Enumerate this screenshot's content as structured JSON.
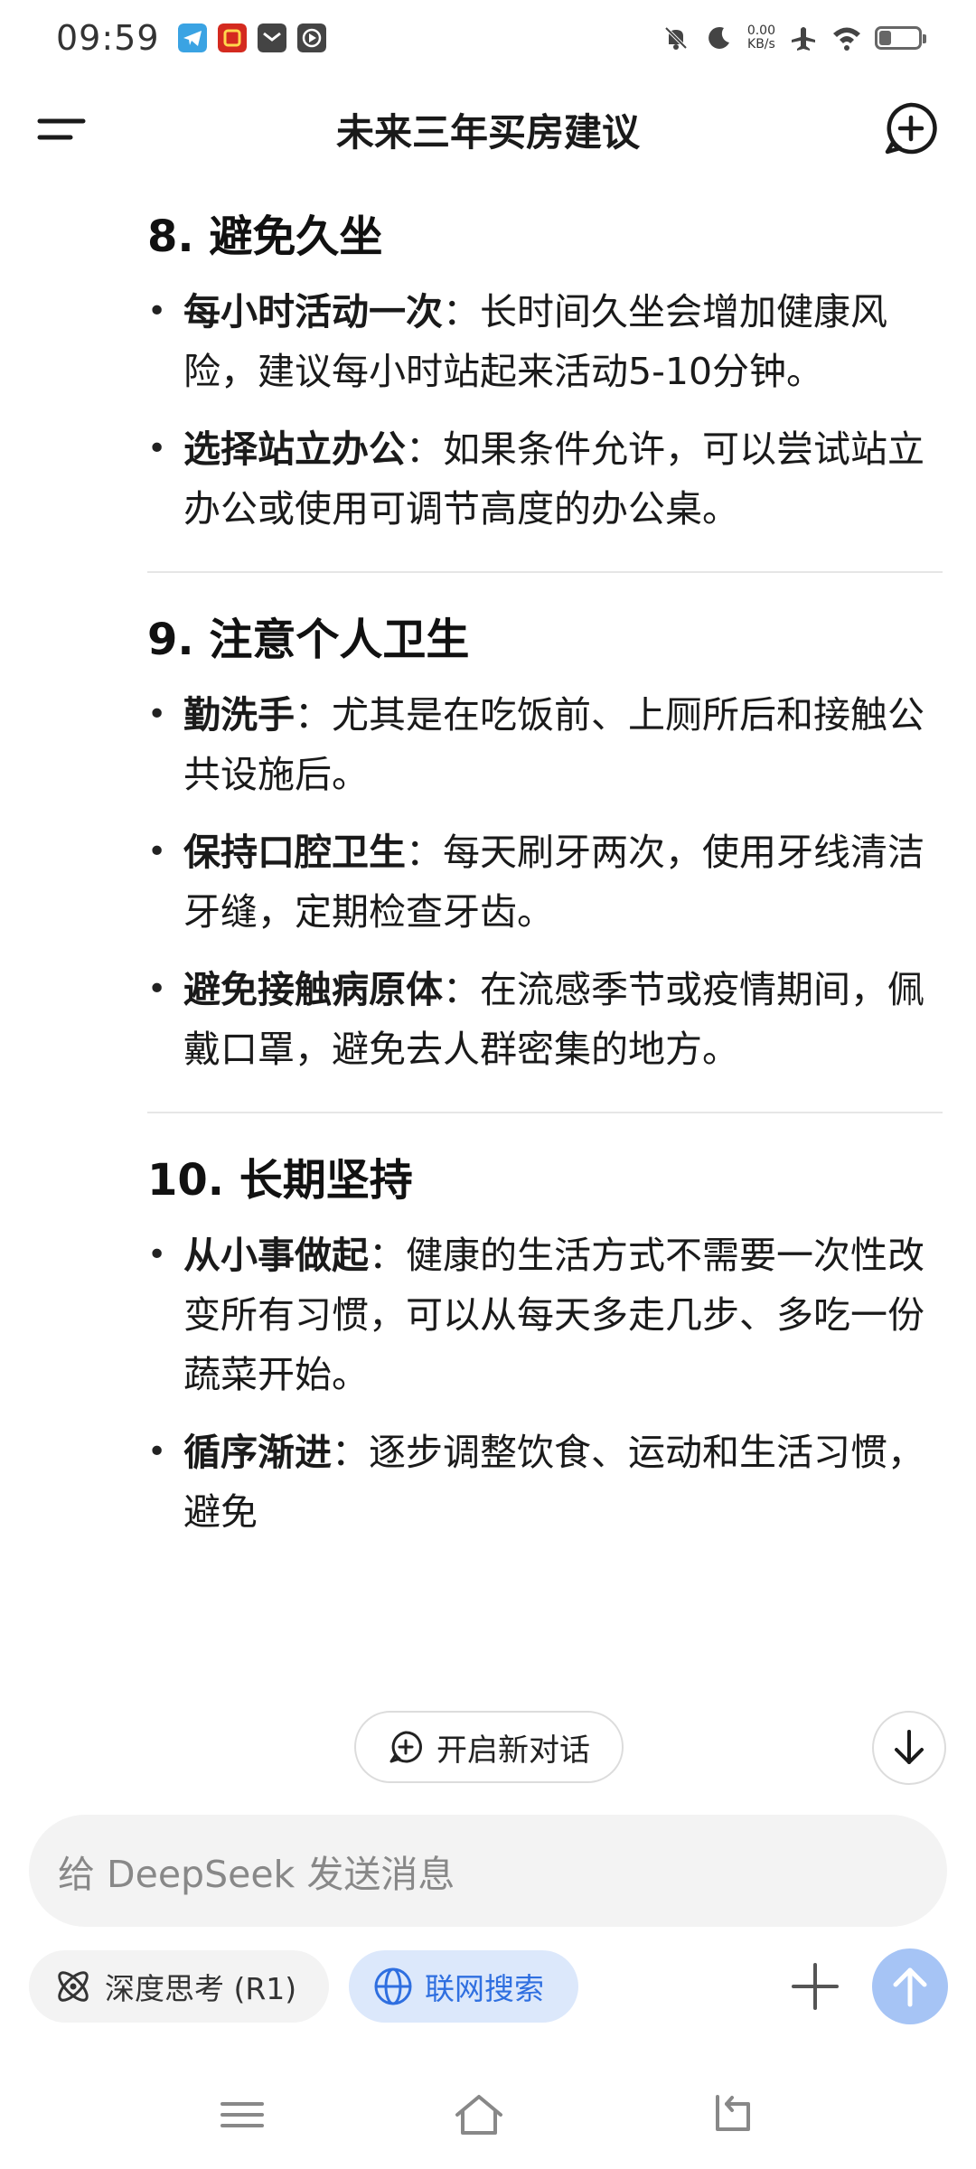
{
  "status_bar": {
    "time": "09:59",
    "speed_value": "0.00",
    "speed_unit": "KB/s"
  },
  "top_bar": {
    "title": "未来三年买房建议"
  },
  "sections": [
    {
      "title": "8. 避免久坐",
      "bullets": [
        {
          "bold": "每小时活动一次",
          "text": "：长时间久坐会增加健康风险，建议每小时站起来活动5-10分钟。"
        },
        {
          "bold": "选择站立办公",
          "text": "：如果条件允许，可以尝试站立办公或使用可调节高度的办公桌。"
        }
      ]
    },
    {
      "title": "9. 注意个人卫生",
      "bullets": [
        {
          "bold": "勤洗手",
          "text": "：尤其是在吃饭前、上厕所后和接触公共设施后。"
        },
        {
          "bold": "保持口腔卫生",
          "text": "：每天刷牙两次，使用牙线清洁牙缝，定期检查牙齿。"
        },
        {
          "bold": "避免接触病原体",
          "text": "：在流感季节或疫情期间，佩戴口罩，避免去人群密集的地方。"
        }
      ]
    },
    {
      "title": "10. 长期坚持",
      "bullets": [
        {
          "bold": "从小事做起",
          "text": "：健康的生活方式不需要一次性改变所有习惯，可以从每天多走几步、多吃一份蔬菜开始。"
        },
        {
          "bold": "循序渐进",
          "text": "：逐步调整饮食、运动和生活习惯，避免"
        }
      ]
    }
  ],
  "floating": {
    "new_chat_label": "开启新对话"
  },
  "input": {
    "placeholder": "给 DeepSeek 发送消息"
  },
  "toolbar": {
    "deep_think_label": "深度思考 (R1)",
    "web_search_label": "联网搜索"
  },
  "colors": {
    "accent": "#2f6fe0",
    "web_chip_bg": "#dce8fb",
    "send_button": "#a6c4f5",
    "input_bg": "#f3f3f3"
  },
  "icons": {
    "menu": "menu-icon",
    "new_chat": "new-chat-icon",
    "scroll_down": "arrow-down-icon",
    "deep_think": "atom-icon",
    "web_search": "globe-icon",
    "plus": "plus-icon",
    "send": "arrow-up-icon"
  }
}
